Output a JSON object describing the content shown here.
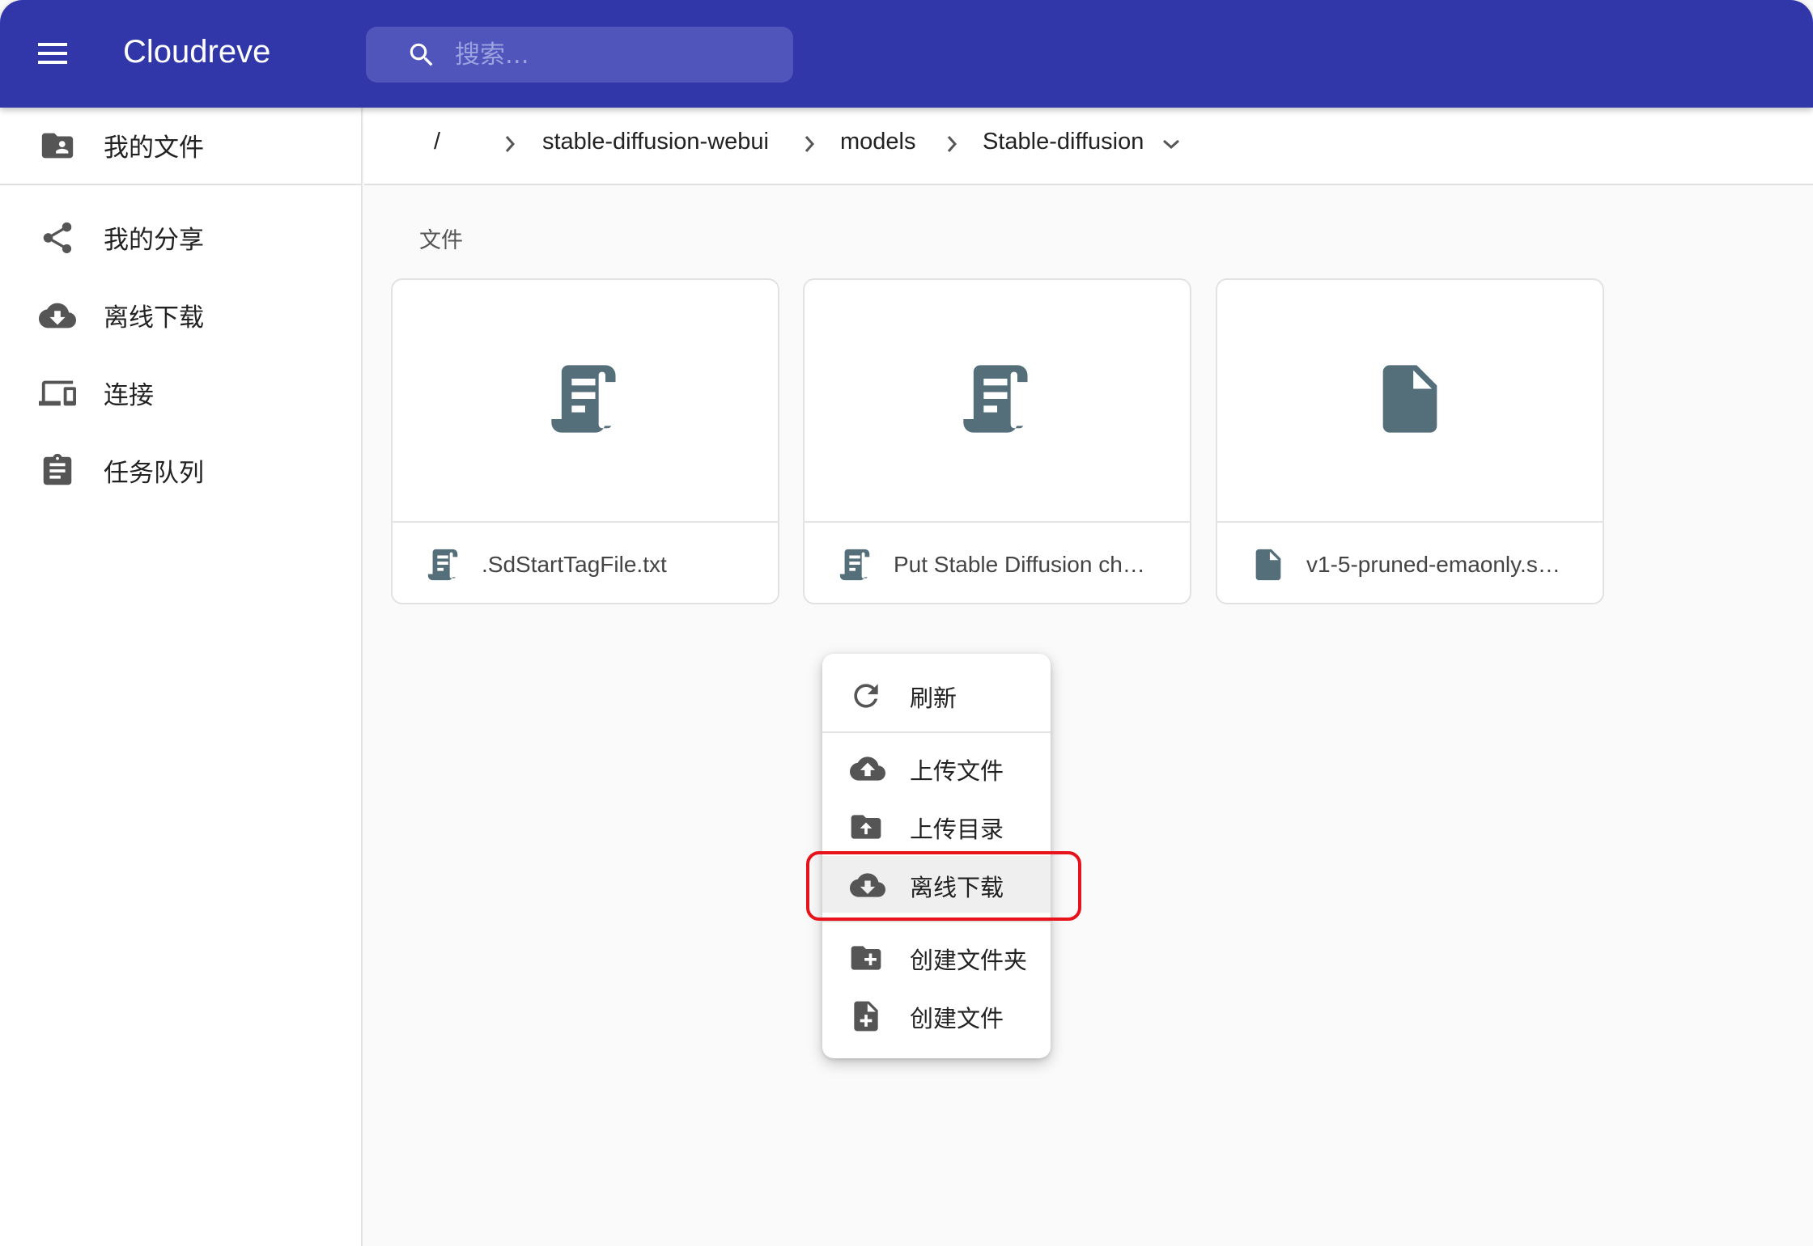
{
  "app": {
    "title": "Cloudreve"
  },
  "search": {
    "placeholder": "搜索..."
  },
  "sidebar": {
    "items": [
      {
        "label": "我的文件",
        "icon": "folder-shared-icon"
      },
      {
        "label": "我的分享",
        "icon": "share-icon"
      },
      {
        "label": "离线下载",
        "icon": "cloud-download-icon"
      },
      {
        "label": "连接",
        "icon": "devices-icon"
      },
      {
        "label": "任务队列",
        "icon": "assignment-icon"
      }
    ]
  },
  "breadcrumb": {
    "root": "/",
    "items": [
      "stable-diffusion-webui",
      "models",
      "Stable-diffusion"
    ]
  },
  "section": {
    "files_label": "文件"
  },
  "files": [
    {
      "name": ".SdStartTagFile.txt",
      "icon": "script-text-icon"
    },
    {
      "name": "Put Stable Diffusion ch…",
      "icon": "script-text-icon"
    },
    {
      "name": "v1-5-pruned-emaonly.s…",
      "icon": "file-icon"
    }
  ],
  "context_menu": {
    "items": [
      {
        "label": "刷新",
        "icon": "refresh-icon"
      },
      {
        "label": "上传文件",
        "icon": "cloud-upload-icon"
      },
      {
        "label": "上传目录",
        "icon": "folder-upload-icon"
      },
      {
        "label": "离线下载",
        "icon": "cloud-download-icon",
        "highlighted": true
      },
      {
        "label": "创建文件夹",
        "icon": "create-folder-icon"
      },
      {
        "label": "创建文件",
        "icon": "create-file-icon"
      }
    ]
  },
  "colors": {
    "appbar": "#3137a8",
    "search_bg": "#4f55ba",
    "file_icon": "#546e7a",
    "highlight": "#e8121a"
  }
}
